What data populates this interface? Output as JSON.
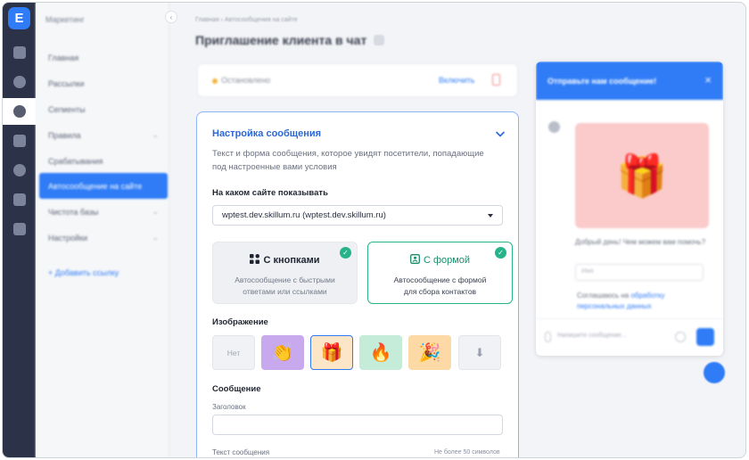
{
  "app": {
    "logo_letter": "E"
  },
  "sidebar": {
    "section_title": "Маркетинг",
    "collapse_glyph": "‹",
    "items": [
      {
        "label": "Главная",
        "chevron": ""
      },
      {
        "label": "Рассылки",
        "chevron": ""
      },
      {
        "label": "Сегменты",
        "chevron": ""
      },
      {
        "label": "Правила",
        "chevron": "⌄"
      },
      {
        "label": "Срабатывания",
        "chevron": ""
      },
      {
        "label": "Автосообщение на сайте",
        "chevron": ""
      },
      {
        "label": "Чистота базы",
        "chevron": "⌄"
      },
      {
        "label": "Настройки",
        "chevron": "⌄"
      }
    ],
    "add_link": "+ Добавить ссылку"
  },
  "header": {
    "breadcrumbs": "Главная › Автосообщения на сайте",
    "title": "Приглашение клиента в чат"
  },
  "status": {
    "text": "Остановлено",
    "enable_label": "Включить",
    "dot_color": "#f3b63a"
  },
  "settings": {
    "title": "Настройка сообщения",
    "description": "Текст и форма сообщения, которое увидят посетители, попадающие под настроенные вами условия",
    "site_label": "На каком сайте показывать",
    "site_value": "wptest.dev.skillum.ru (wptest.dev.skillum.ru)",
    "types": [
      {
        "title": "С кнопками",
        "icon": "grid-icon",
        "desc_line1": "Автосообщение с быстрыми",
        "desc_line2": "ответами или ссылками",
        "selected": false
      },
      {
        "title": "С формой",
        "icon": "form-icon",
        "desc_line1": "Автосообщение с формой",
        "desc_line2": "для сбора контактов",
        "selected": true
      }
    ],
    "image_label": "Изображение",
    "images": [
      {
        "label": "Нет",
        "emoji": "",
        "bg": "#f1f2f5",
        "kind": "none"
      },
      {
        "label": "",
        "emoji": "👏",
        "bg": "#c9a9ee",
        "kind": "image"
      },
      {
        "label": "",
        "emoji": "🎁",
        "bg": "#fce6c7",
        "kind": "image",
        "selected": true
      },
      {
        "label": "",
        "emoji": "🔥",
        "bg": "#c5ecd8",
        "kind": "image"
      },
      {
        "label": "",
        "emoji": "🎉",
        "bg": "#fcd9a5",
        "kind": "image"
      },
      {
        "label": "",
        "emoji": "⬇",
        "bg": "#f1f2f5",
        "kind": "upload"
      }
    ],
    "message_label": "Сообщение",
    "heading_label": "Заголовок",
    "text_label": "Текст сообщения",
    "text_limit": "Не более 50 символов"
  },
  "widget": {
    "header_title": "Отправьте нам сообщение!",
    "close_glyph": "×",
    "picture_emoji": "🎁",
    "greeting": "Добрый день! Чем можем вам помочь?",
    "input_placeholder": "Имя",
    "agree_text": "Соглашаюсь на",
    "agree_link": "обработку персональных данных",
    "message_placeholder": "Напишите сообщение..."
  },
  "colors": {
    "accent": "#2f7cf6",
    "selected_green": "#27b38a",
    "rail": "#2c3349"
  }
}
